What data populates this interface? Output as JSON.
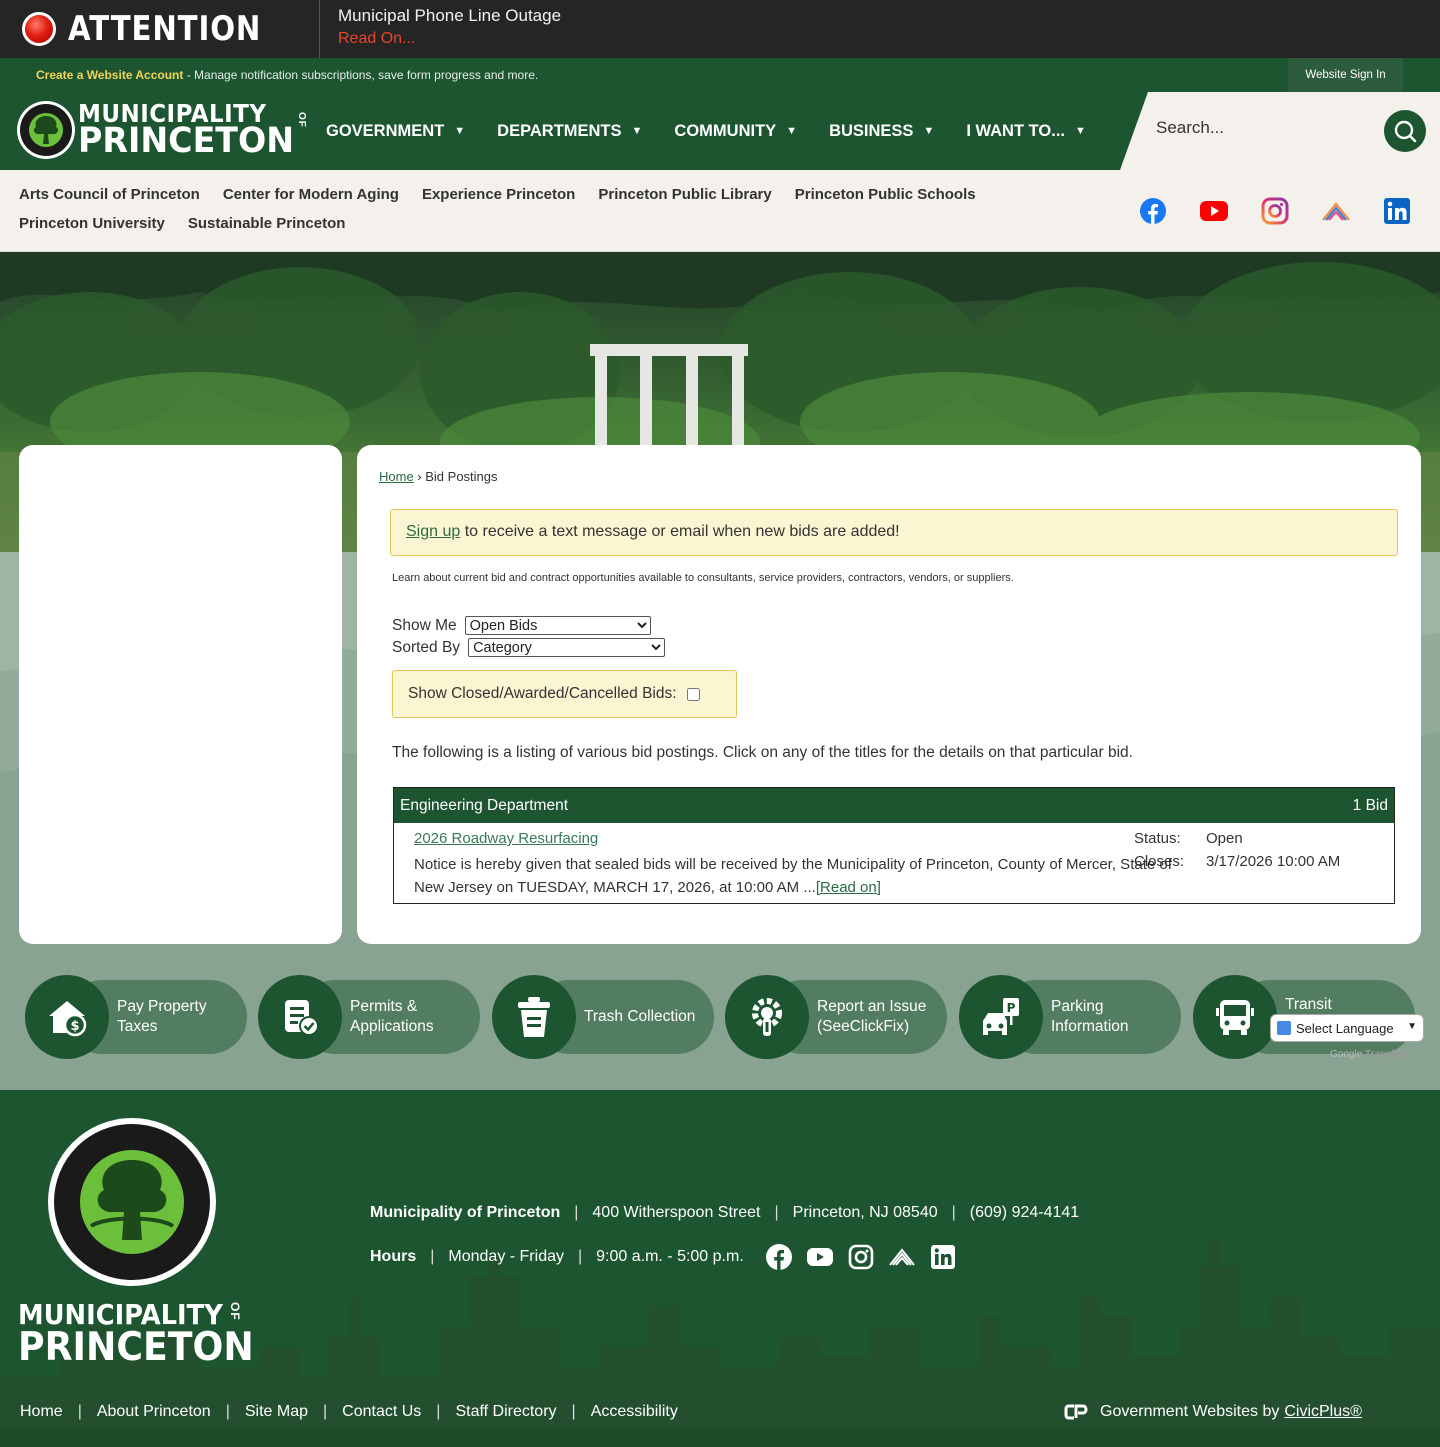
{
  "alert": {
    "label": "ATTENTION",
    "title": "Municipal Phone Line Outage",
    "read_on": "Read On..."
  },
  "account": {
    "create_label": "Create a Website Account",
    "create_desc": " - Manage notification subscriptions, save form progress and more.",
    "signin": "Website Sign In"
  },
  "logo": {
    "line1": "MUNICIPALITY",
    "line2": "PRINCETON",
    "of": "OF"
  },
  "nav": {
    "items": [
      {
        "label": "GOVERNMENT"
      },
      {
        "label": "DEPARTMENTS"
      },
      {
        "label": "COMMUNITY"
      },
      {
        "label": "BUSINESS"
      },
      {
        "label": "I WANT TO..."
      }
    ],
    "caret": "▼"
  },
  "search": {
    "placeholder": "Search..."
  },
  "quick_links": {
    "row1": [
      "Arts Council of Princeton",
      "Center for Modern Aging",
      "Experience Princeton",
      "Princeton Public Library",
      "Princeton Public Schools"
    ],
    "row2": [
      "Princeton University",
      "Sustainable Princeton"
    ]
  },
  "socials": [
    "facebook-icon",
    "youtube-icon",
    "instagram-icon",
    "flickr-icon",
    "linkedin-icon"
  ],
  "breadcrumb": {
    "home": "Home",
    "sep": " › ",
    "current": "Bid Postings"
  },
  "signup": {
    "link": "Sign up",
    "text": " to receive a text message or email when new bids are added!"
  },
  "learn_text": "Learn about current bid and contract opportunities available to consultants, service providers, contractors, vendors, or suppliers.",
  "filters": {
    "show_me_label": "Show Me",
    "show_me_value": "Open Bids",
    "sorted_by_label": "Sorted By",
    "sorted_by_value": "Category",
    "closed_label": "Show Closed/Awarded/Cancelled Bids:"
  },
  "listing_text": "The following is a listing of various bid postings. Click on any of the titles for the details on that particular bid.",
  "bid_group": {
    "department": "Engineering Department",
    "count": "1 Bid",
    "bids": [
      {
        "title": "2026 Roadway Resurfacing",
        "desc": "Notice is hereby given that sealed bids will be received by the Municipality of Princeton, County of Mercer, State of New Jersey on TUESDAY, MARCH 17, 2026, at 10:00 AM ...",
        "read_on": "[Read on]",
        "status_label": "Status:",
        "status_value": "Open",
        "closes_label": "Closes:",
        "closes_value": "3/17/2026 10:00 AM"
      }
    ]
  },
  "actions": [
    {
      "label": "Pay Property Taxes",
      "icon": "house-dollar-icon"
    },
    {
      "label": "Permits & Applications",
      "icon": "document-check-icon"
    },
    {
      "label": "Trash Collection",
      "icon": "trash-can-icon"
    },
    {
      "label": "Report an Issue (SeeClickFix)",
      "icon": "wrench-gear-icon"
    },
    {
      "label": "Parking Information",
      "icon": "car-parking-icon"
    },
    {
      "label": "Transit",
      "icon": "bus-icon"
    }
  ],
  "translate": {
    "label": "Select Language",
    "powered_prefix": "Google",
    "powered": "Translate"
  },
  "footer": {
    "name_line1": "MUNICIPALITY",
    "name_line2": "PRINCETON",
    "of": "OF",
    "org": "Municipality of Princeton",
    "street": "400 Witherspoon Street",
    "city": "Princeton, NJ 08540",
    "phone": "(609) 924-4141",
    "hours_label": "Hours",
    "days": "Monday - Friday",
    "time": "9:00 a.m. - 5:00 p.m.",
    "links": [
      "Home",
      "About Princeton",
      "Site Map",
      "Contact Us",
      "Staff Directory",
      "Accessibility"
    ],
    "civic_text": "Government Websites by",
    "civic_link": "CivicPlus®"
  },
  "colors": {
    "brand_green": "#1c5530",
    "alert_red": "#e8452c",
    "highlight_yellow": "#fcf5d2",
    "account_yellow": "#f3d35a"
  }
}
